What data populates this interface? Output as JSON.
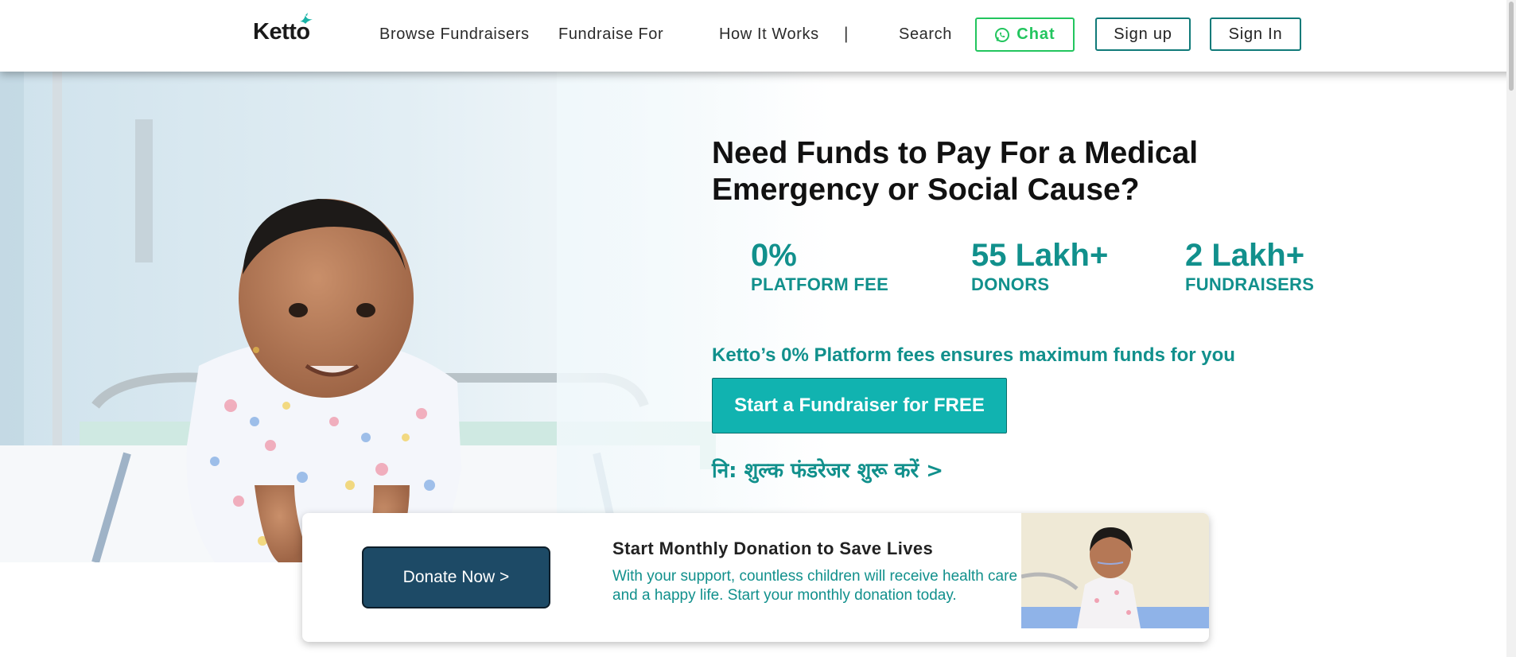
{
  "header": {
    "logo_text": "Ketto",
    "nav": {
      "browse": "Browse Fundraisers",
      "fundraise_for": "Fundraise For",
      "how_it_works": "How It Works",
      "separator": "|",
      "search": "Search"
    },
    "chat_label": "Chat",
    "signup_label": "Sign up",
    "signin_label": "Sign In"
  },
  "hero": {
    "title": "Need Funds to Pay For a Medical Emergency or Social Cause?",
    "stats": [
      {
        "value": "0%",
        "label": "PLATFORM FEE"
      },
      {
        "value": "55 Lakh+",
        "label": "DONORS"
      },
      {
        "value": "2 Lakh+",
        "label": "FUNDRAISERS"
      }
    ],
    "tagline": "Ketto’s 0% Platform fees ensures maximum funds for you",
    "cta_label": "Start a Fundraiser for FREE",
    "hindi_link": "नि: शुल्क फंडरेजर शुरू करें >"
  },
  "donation_card": {
    "button_label": "Donate Now >",
    "title": "Start Monthly Donation to Save Lives",
    "text": "With your support, countless children will receive health care and a happy life. Start your monthly donation today."
  },
  "colors": {
    "brand_teal": "#11908c",
    "cta_teal": "#11b3b0",
    "chat_green": "#22c55e",
    "donate_navy": "#1d4a66"
  },
  "icons": {
    "logo_mark": "bird-icon",
    "chat": "whatsapp-icon"
  }
}
